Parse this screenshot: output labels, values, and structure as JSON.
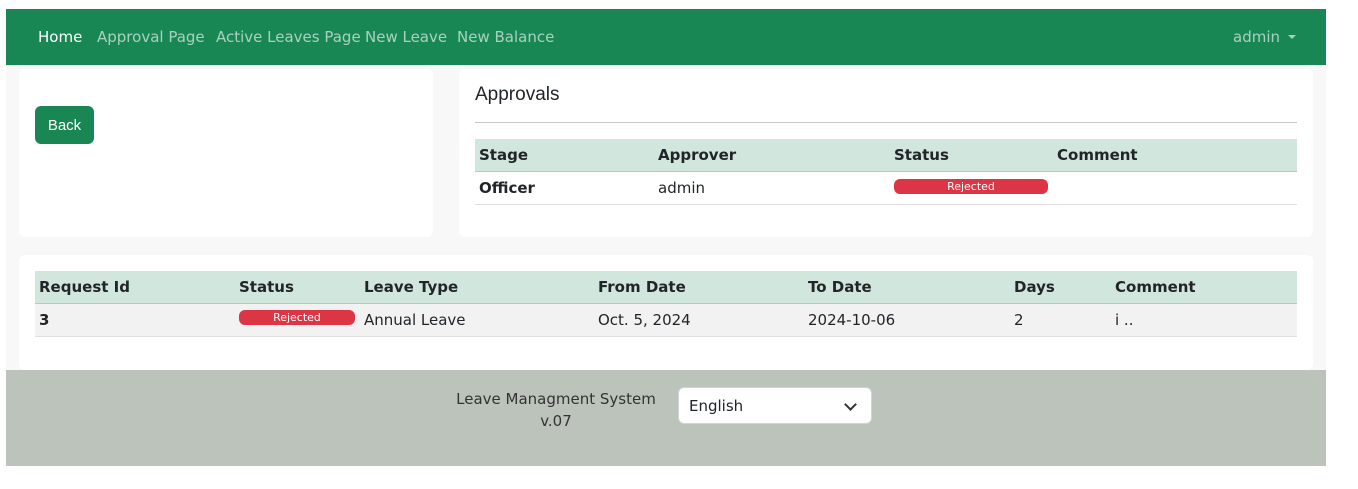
{
  "navbar": {
    "links": [
      "Home",
      "Approval Page",
      "Active Leaves Page",
      "New Leave",
      "New Balance"
    ],
    "user": "admin"
  },
  "left_card": {
    "back_label": "Back"
  },
  "approvals": {
    "title": "Approvals",
    "headers": [
      "Stage",
      "Approver",
      "Status",
      "Comment"
    ],
    "rows": [
      {
        "stage": "Officer",
        "approver": "admin",
        "status": "Rejected",
        "comment": ""
      }
    ]
  },
  "requests": {
    "headers": [
      "Request Id",
      "Status",
      "Leave Type",
      "From Date",
      "To Date",
      "Days",
      "Comment"
    ],
    "rows": [
      {
        "request_id": "3",
        "status": "Rejected",
        "leave_type": "Annual Leave",
        "from_date": "Oct. 5, 2024",
        "to_date": "2024-10-06",
        "days": "2",
        "comment": "i .."
      }
    ]
  },
  "footer": {
    "system_name": "Leave Managment System",
    "version": "v.07",
    "language": "English"
  },
  "colors": {
    "brand": "#198754",
    "danger": "#dc3545",
    "table_header": "#d1e7dd",
    "footer": "#bcc3bb"
  }
}
